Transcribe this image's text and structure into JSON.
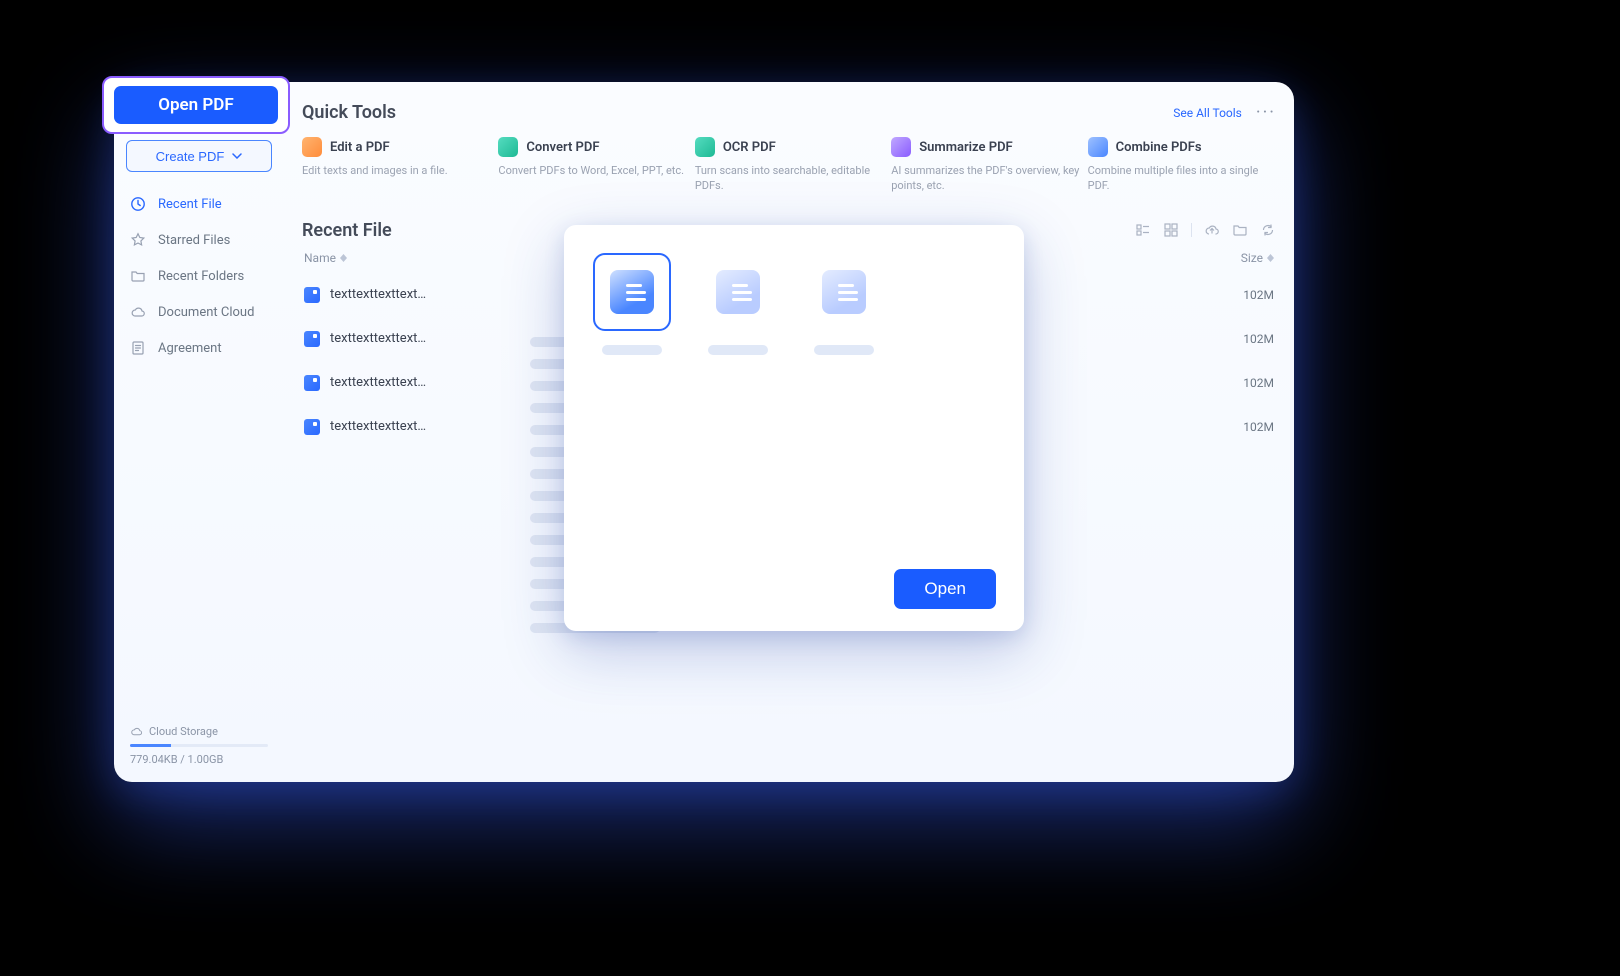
{
  "callout": {
    "open_pdf_label": "Open PDF"
  },
  "sidebar": {
    "create_label": "Create PDF",
    "items": [
      {
        "label": "Recent File"
      },
      {
        "label": "Starred Files"
      },
      {
        "label": "Recent Folders"
      },
      {
        "label": "Document Cloud"
      },
      {
        "label": "Agreement"
      }
    ],
    "storage_label": "Cloud Storage",
    "storage_text": "779.04KB / 1.00GB"
  },
  "quick": {
    "title": "Quick Tools",
    "see_all": "See All Tools",
    "tools": [
      {
        "name": "Edit a PDF",
        "desc": "Edit texts and images in a file.",
        "color": "#ff9a3d"
      },
      {
        "name": "Convert PDF",
        "desc": "Convert PDFs to Word, Excel, PPT, etc.",
        "color": "#2cc6a6"
      },
      {
        "name": "OCR PDF",
        "desc": "Turn scans into searchable, editable PDFs.",
        "color": "#2cc6a6"
      },
      {
        "name": "Summarize PDF",
        "desc": "AI summarizes the PDF's overview, key points, etc.",
        "color": "#8a5cff"
      },
      {
        "name": "Combine PDFs",
        "desc": "Combine multiple files into a single PDF.",
        "color": "#4a86ff"
      }
    ]
  },
  "recent": {
    "title": "Recent File",
    "col_name": "Name",
    "col_size": "Size",
    "rows": [
      {
        "name": "texttexttexttexttext",
        "size": "102M"
      },
      {
        "name": "texttexttexttexttext",
        "size": "102M"
      },
      {
        "name": "texttexttexttexttext",
        "size": "102M"
      },
      {
        "name": "texttexttexttexttext",
        "size": "102M"
      }
    ]
  },
  "dialog": {
    "open_label": "Open"
  }
}
